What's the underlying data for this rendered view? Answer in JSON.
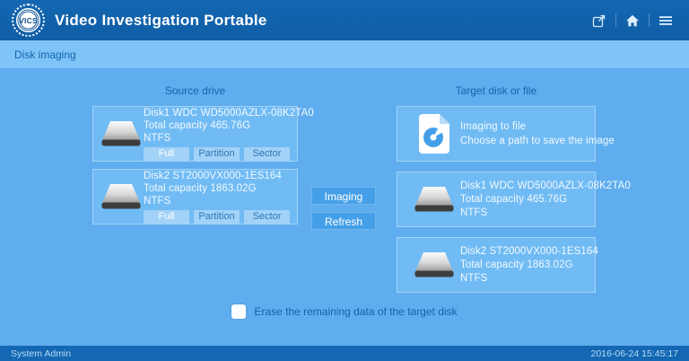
{
  "header": {
    "logo_text": "VICS",
    "title": "Video Investigation Portable",
    "icons": [
      {
        "name": "export-icon"
      },
      {
        "name": "home-icon"
      },
      {
        "name": "menu-icon"
      }
    ]
  },
  "breadcrumb": {
    "label": "Disk imaging"
  },
  "source": {
    "title": "Source drive",
    "disks": [
      {
        "name": "Disk1 WDC WD5000AZLX-08K2TA0",
        "capacity": "Total capacity 465.76G",
        "filesystem": "NTFS",
        "modes": [
          "Full",
          "Partition",
          "Sector"
        ],
        "selected_mode": "Full"
      },
      {
        "name": "Disk2 ST2000VX000-1ES164",
        "capacity": "Total capacity 1863.02G",
        "filesystem": "NTFS",
        "modes": [
          "Full",
          "Partition",
          "Sector"
        ],
        "selected_mode": "Full"
      }
    ]
  },
  "actions": {
    "imaging_label": "Imaging",
    "refresh_label": "Refresh"
  },
  "target": {
    "title": "Target disk or file",
    "file_option": {
      "line1": "Imaging to file",
      "line2": "Choose a path to save the image"
    },
    "disks": [
      {
        "name": "Disk1 WDC WD5000AZLX-08K2TA0",
        "capacity": "Total capacity 465.76G",
        "filesystem": "NTFS"
      },
      {
        "name": "Disk2 ST2000VX000-1ES164",
        "capacity": "Total capacity 1863.02G",
        "filesystem": "NTFS"
      }
    ]
  },
  "erase": {
    "label": "Erase the remaining data of the target disk",
    "checked": false
  },
  "footer": {
    "user": "System Admin",
    "timestamp": "2016-06-24 15:45:17"
  },
  "colors": {
    "bar": "#1467b2",
    "bar_dark": "#0f5da5",
    "sub_bar": "#7ec4f8",
    "main_bg": "#5fadee",
    "card_bg": "#70bbf4",
    "mode_bg": "#a2d2f7",
    "mode_ink": "#2e77b8",
    "btn_bg": "#459fe8",
    "ink": "#1464ad",
    "card_text": "#f2f9ff",
    "footer_text": "#b5dcf7"
  }
}
